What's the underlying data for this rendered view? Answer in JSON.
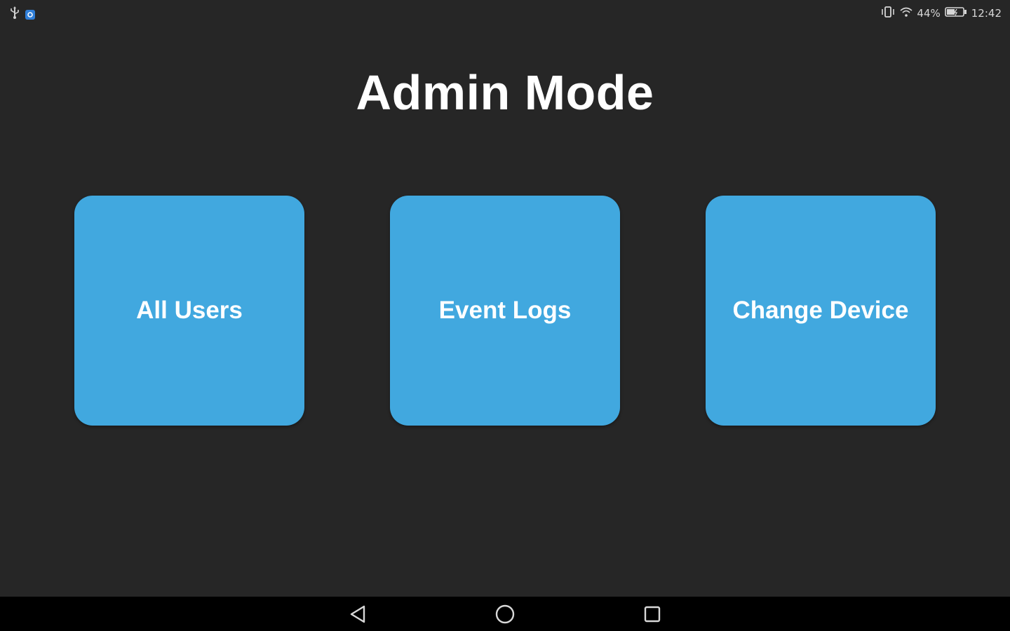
{
  "status_bar": {
    "left_icons": [
      "usb-icon",
      "app-notification-icon"
    ],
    "right_icons": [
      "vibrate-icon",
      "wifi-icon",
      "battery-icon"
    ],
    "battery_percent": "44%",
    "time": "12:42"
  },
  "page": {
    "title": "Admin Mode"
  },
  "tiles": [
    {
      "label": "All Users"
    },
    {
      "label": "Event Logs"
    },
    {
      "label": "Change Device"
    }
  ],
  "nav_bar": {
    "icons": [
      "back-icon",
      "home-icon",
      "recents-icon"
    ]
  },
  "colors": {
    "background": "#262626",
    "tile": "#41a8df",
    "nav_bar": "#000000",
    "text": "#ffffff"
  }
}
